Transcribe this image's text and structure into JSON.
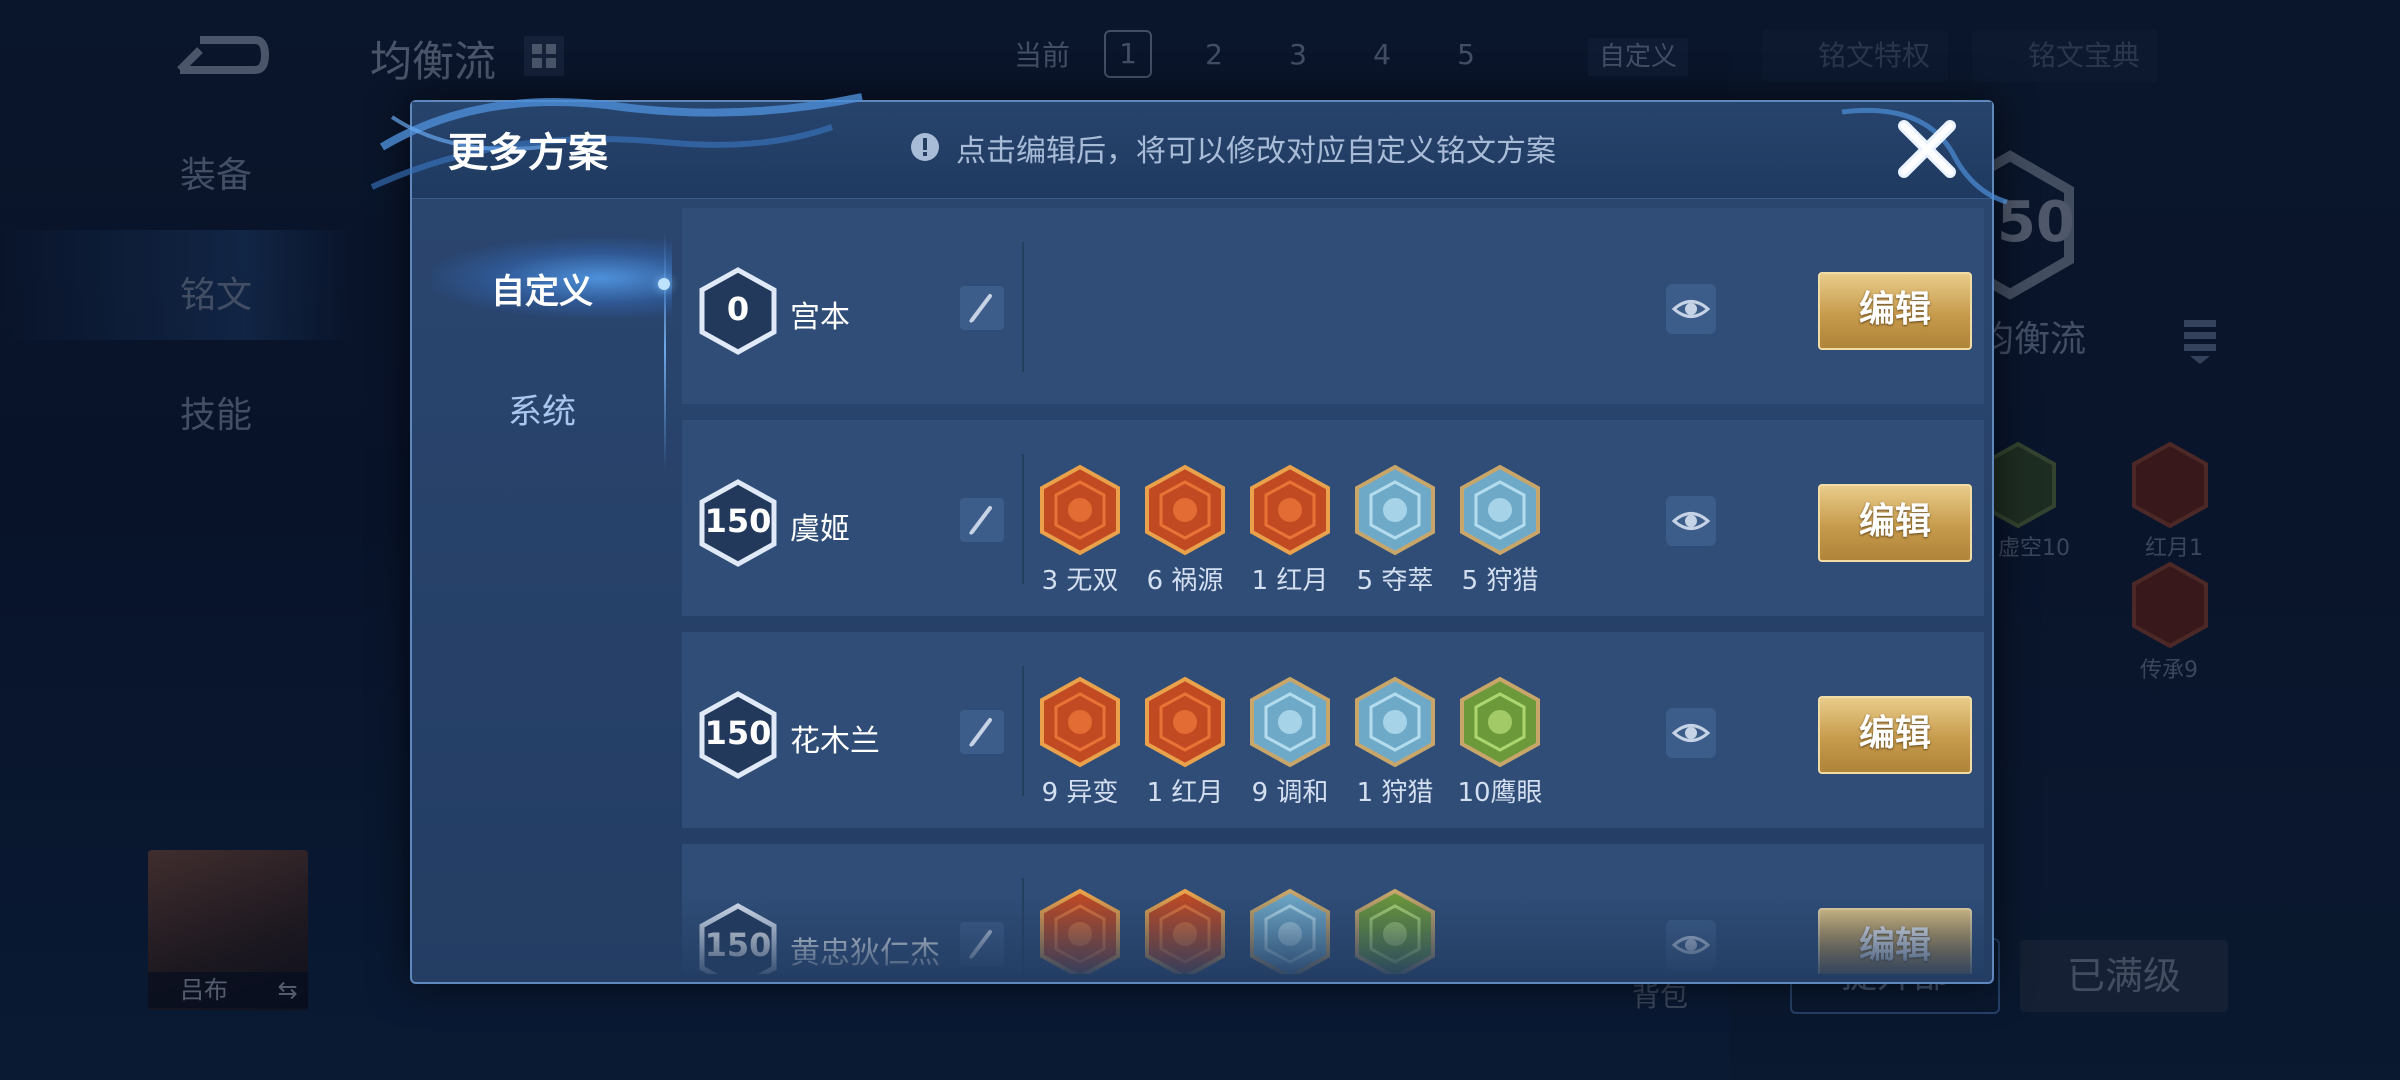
{
  "background": {
    "title": "均衡流",
    "page_tabs": {
      "current_label": "当前",
      "pages": [
        "1",
        "2",
        "3",
        "4",
        "5"
      ],
      "custom_label": "自定义"
    },
    "privilege_button": "铭文特权",
    "codex_button": "铭文宝典",
    "left_nav": [
      "装备",
      "铭文",
      "技能"
    ],
    "level_badge": "150",
    "preset_name": "均衡流",
    "rune_labels": [
      "虚空10",
      "红月1",
      "传承9"
    ],
    "hero_name": "吕布",
    "bag_label": "背包",
    "upgrade_label": "提升部",
    "maxed_label": "已满级"
  },
  "modal": {
    "title": "更多方案",
    "hint": "点击编辑后，将可以修改对应自定义铭文方案",
    "tabs": [
      {
        "label": "自定义",
        "active": true
      },
      {
        "label": "系统",
        "active": false
      }
    ],
    "edit_label": "编辑",
    "rows": [
      {
        "level": "0",
        "name": "宫本",
        "runes": []
      },
      {
        "level": "150",
        "name": "虞姬",
        "runes": [
          {
            "label": "3 无双",
            "icon": "rune-wushuang-icon",
            "color": "red"
          },
          {
            "label": "6 祸源",
            "icon": "rune-huoyuan-icon",
            "color": "red"
          },
          {
            "label": "1 红月",
            "icon": "rune-hongyue-icon",
            "color": "red"
          },
          {
            "label": "5 夺萃",
            "icon": "rune-duocui-icon",
            "color": "blue"
          },
          {
            "label": "5 狩猎",
            "icon": "rune-shoulie-icon",
            "color": "blue"
          }
        ]
      },
      {
        "level": "150",
        "name": "花木兰",
        "runes": [
          {
            "label": "9 异变",
            "icon": "rune-yibian-icon",
            "color": "red"
          },
          {
            "label": "1 红月",
            "icon": "rune-hongyue-icon",
            "color": "red"
          },
          {
            "label": "9 调和",
            "icon": "rune-tiaohe-icon",
            "color": "blue"
          },
          {
            "label": "1 狩猎",
            "icon": "rune-shoulie-icon",
            "color": "blue"
          },
          {
            "label": "10鹰眼",
            "icon": "rune-yingyan-icon",
            "color": "green"
          }
        ]
      },
      {
        "level": "150",
        "name": "黄忠狄仁杰",
        "runes": [
          {
            "label": "",
            "icon": "rune-wushuang-icon",
            "color": "red"
          },
          {
            "label": "",
            "icon": "rune-hongyue-icon",
            "color": "red"
          },
          {
            "label": "",
            "icon": "rune-tiaohe-icon",
            "color": "blue"
          },
          {
            "label": "",
            "icon": "rune-yingyan-icon",
            "color": "green"
          }
        ]
      }
    ]
  },
  "colors": {
    "gold": "#c79b4c",
    "panel": "#2f4d77",
    "accent": "#6fa7e6"
  }
}
